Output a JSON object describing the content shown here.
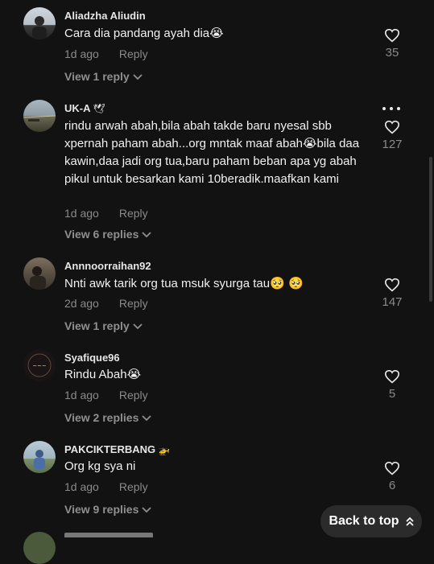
{
  "comments": [
    {
      "username": "Aliadzha Aliudin",
      "username_emoji": "",
      "text": "Cara dia pandang ayah dia😭",
      "time": "1d ago",
      "reply_label": "Reply",
      "view_replies": "View 1 reply",
      "likes": "35"
    },
    {
      "username": "UK-A",
      "username_emoji": "🕊",
      "text": "rindu arwah abah,bila abah takde baru nyesal sbb xpernah paham abah...org mntak maaf abah😭bila daa kawin,daa jadi org tua,baru paham beban apa yg abah pikul untuk besarkan kami 10beradik.maafkan kami",
      "time": "1d ago",
      "reply_label": "Reply",
      "view_replies": "View 6 replies",
      "likes": "127"
    },
    {
      "username": "Annnoorraihan92",
      "username_emoji": "",
      "text": "Nnti awk tarik org tua msuk syurga tau🥺 🥺",
      "time": "2d ago",
      "reply_label": "Reply",
      "view_replies": "View 1 reply",
      "likes": "147"
    },
    {
      "username": "Syafique96",
      "username_emoji": "",
      "text": "Rindu Abah😭",
      "time": "1d ago",
      "reply_label": "Reply",
      "view_replies": "View 2 replies",
      "likes": "5"
    },
    {
      "username": "PAKCIKTERBANG",
      "username_emoji": "🚁",
      "text": "Org kg sya ni",
      "time": "1d ago",
      "reply_label": "Reply",
      "view_replies": "View 9 replies",
      "likes": "6"
    }
  ],
  "back_to_top": "Back to top",
  "colors": {
    "background": "#121212",
    "muted": "#8a8a8a",
    "button_bg": "#2b2b2b"
  }
}
